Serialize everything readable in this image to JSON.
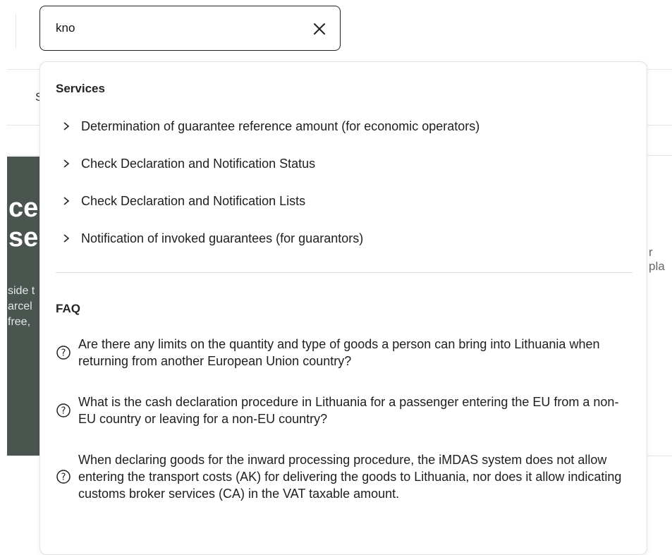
{
  "background": {
    "tab_fragment": "S",
    "hero_title_lines": [
      "ce",
      "sel"
    ],
    "hero_text_lines": [
      "side t",
      "arcel",
      "free,"
    ],
    "right_fragment": "r pla"
  },
  "search": {
    "value": "kno",
    "placeholder": "",
    "clear_icon": "close-icon"
  },
  "dropdown": {
    "services_heading": "Services",
    "services": [
      {
        "label": "Determination of guarantee reference amount (for economic operators)"
      },
      {
        "label": "Check Declaration and Notification Status"
      },
      {
        "label": "Check Declaration and Notification Lists"
      },
      {
        "label": "Notification of invoked guarantees (for guarantors)"
      }
    ],
    "faq_heading": "FAQ",
    "faq": [
      {
        "question": "Are there any limits on the quantity and type of goods a person can bring into Lithuania when returning from another European Union country?"
      },
      {
        "question": "What is the cash declaration procedure in Lithuania for a passenger entering the EU from a non-EU country or leaving for a non-EU country?"
      },
      {
        "question": "When declaring goods for the inward processing procedure, the iMDAS system does not allow entering the transport costs (AK) for delivering the goods to Lithuania, nor does it allow indicating customs broker services (CA) in the VAT taxable amount."
      }
    ]
  },
  "colors": {
    "hero_bg": "#4a5550",
    "border": "#222222",
    "text": "#1e1e1e"
  }
}
